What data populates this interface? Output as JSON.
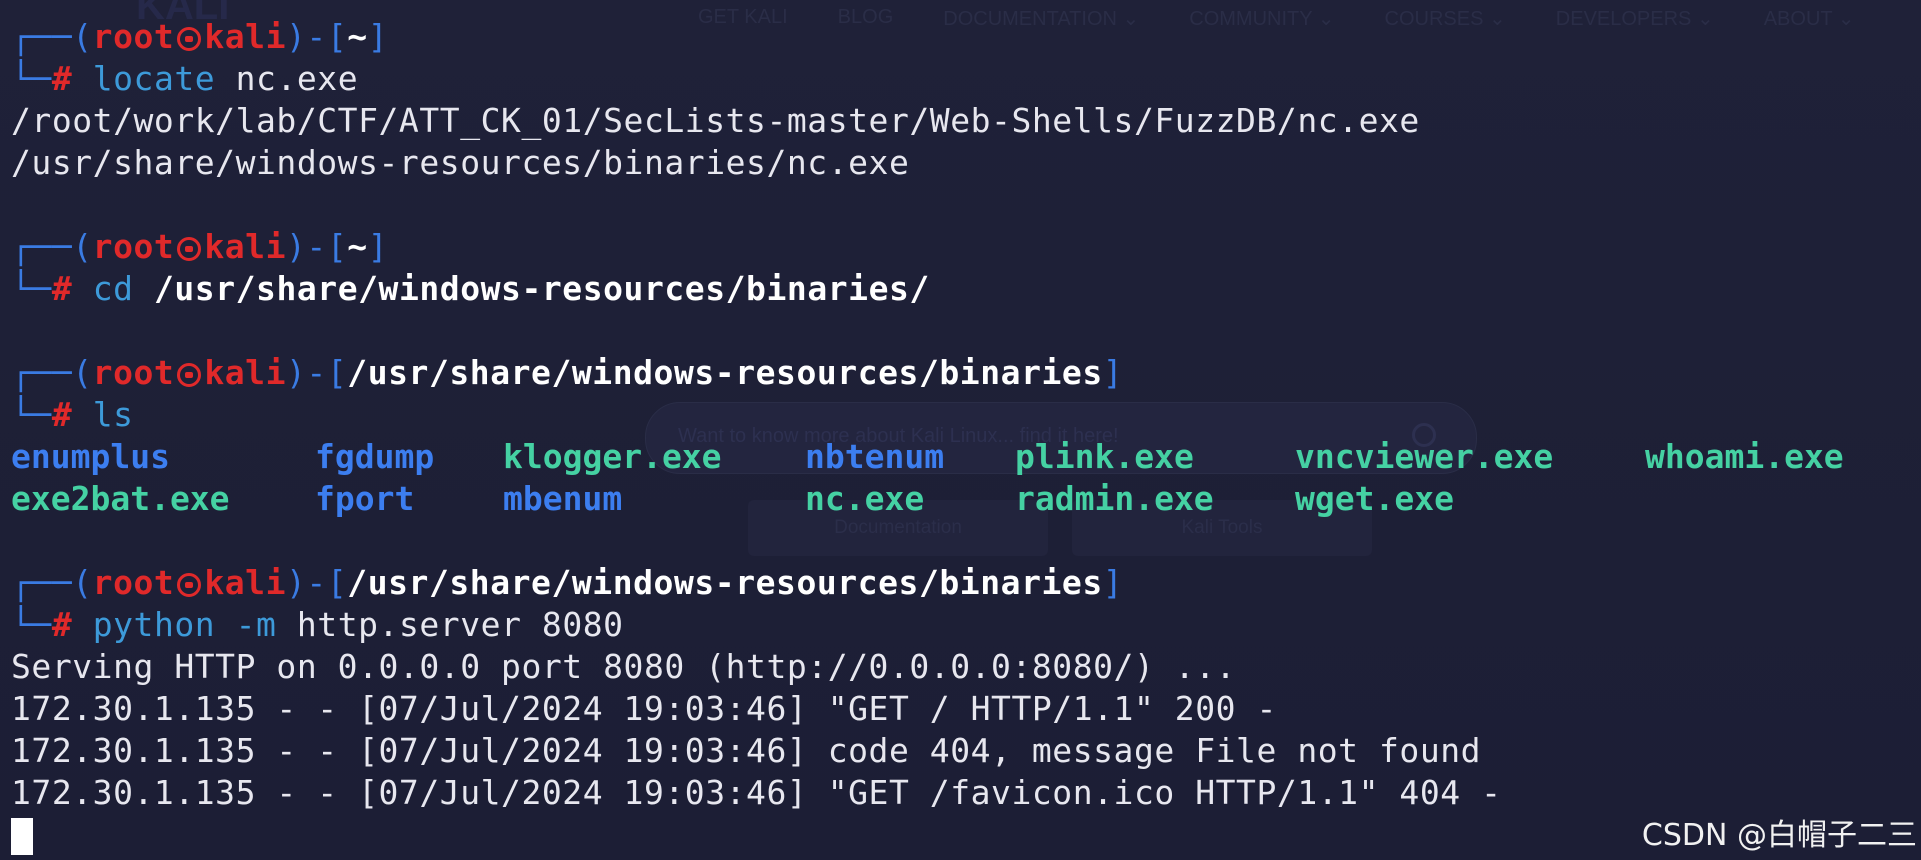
{
  "background_site": {
    "logo": "KALI",
    "nav": [
      "GET KALI",
      "BLOG",
      "DOCUMENTATION ⌄",
      "COMMUNITY ⌄",
      "COURSES ⌄",
      "DEVELOPERS ⌄",
      "ABOUT ⌄"
    ],
    "search_placeholder": "Want to know more about Kali Linux... find it here!",
    "buttons": [
      "Documentation",
      "Kali Tools"
    ]
  },
  "prompt": {
    "open": "┌──(",
    "user": "root",
    "host": "kali",
    "mid": ")-[",
    "close": "]",
    "second": "└─",
    "hash": "#"
  },
  "blocks": [
    {
      "cwd": "~",
      "cmd": "locate",
      "args": " nc.exe",
      "output": [
        "/root/work/lab/CTF/ATT_CK_01/SecLists-master/Web-Shells/FuzzDB/nc.exe",
        "/usr/share/windows-resources/binaries/nc.exe"
      ]
    },
    {
      "cwd": "~",
      "cmd": "cd",
      "args": " /usr/share/windows-resources/binaries/"
    },
    {
      "cwd": "/usr/share/windows-resources/binaries",
      "cmd": "ls",
      "args": ""
    },
    {
      "cwd": "/usr/share/windows-resources/binaries",
      "cmd": "python",
      "cmd2": " -m",
      "args": " http.server 8080",
      "output": [
        "Serving HTTP on 0.0.0.0 port 8080 (http://0.0.0.0:8080/) ...",
        "172.30.1.135 - - [07/Jul/2024 19:03:46] \"GET / HTTP/1.1\" 200 -",
        "172.30.1.135 - - [07/Jul/2024 19:03:46] code 404, message File not found",
        "172.30.1.135 - - [07/Jul/2024 19:03:46] \"GET /favicon.ico HTTP/1.1\" 404 -"
      ]
    }
  ],
  "ls_listing": [
    [
      {
        "name": "enumplus",
        "type": "dir"
      },
      {
        "name": "fgdump",
        "type": "dir"
      },
      {
        "name": "klogger.exe",
        "type": "exe"
      },
      {
        "name": "nbtenum",
        "type": "dir"
      },
      {
        "name": "plink.exe",
        "type": "exe"
      },
      {
        "name": "vncviewer.exe",
        "type": "exe"
      },
      {
        "name": "whoami.exe",
        "type": "exe"
      }
    ],
    [
      {
        "name": "exe2bat.exe",
        "type": "exe"
      },
      {
        "name": "fport",
        "type": "dir"
      },
      {
        "name": "mbenum",
        "type": "dir"
      },
      {
        "name": "nc.exe",
        "type": "exe"
      },
      {
        "name": "radmin.exe",
        "type": "exe"
      },
      {
        "name": "wget.exe",
        "type": "exe"
      }
    ]
  ],
  "colors": {
    "background": "#1d1f37",
    "prompt_box": "#3a7be3",
    "user_host": "#e0292a",
    "command": "#3d9ad9",
    "directory": "#3c7ef0",
    "executable": "#45d1a3",
    "text": "#e7e7ef"
  },
  "watermark": "CSDN @白帽子二三"
}
